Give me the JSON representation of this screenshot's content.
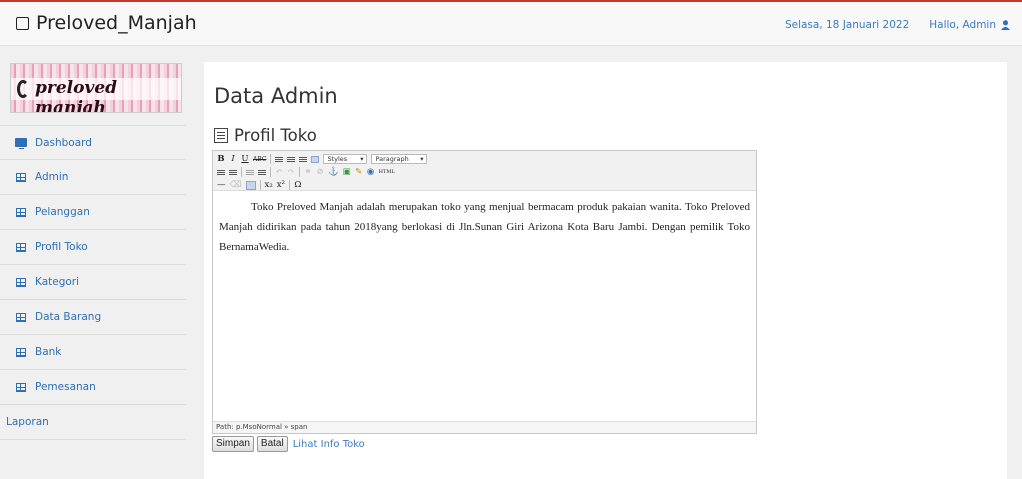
{
  "header": {
    "brand": "Preloved_Manjah",
    "date": "Selasa, 18 Januari 2022",
    "greeting": "Hallo, Admin"
  },
  "sidebar": {
    "items": [
      {
        "label": "Dashboard",
        "icon": "monitor-icon"
      },
      {
        "label": "Admin",
        "icon": "table-icon"
      },
      {
        "label": "Pelanggan",
        "icon": "table-icon"
      },
      {
        "label": "Profil Toko",
        "icon": "table-icon"
      },
      {
        "label": "Kategori",
        "icon": "table-icon"
      },
      {
        "label": "Data Barang",
        "icon": "table-icon"
      },
      {
        "label": "Bank",
        "icon": "table-icon"
      },
      {
        "label": "Pemesanan",
        "icon": "table-icon"
      },
      {
        "label": "Laporan",
        "icon": ""
      }
    ]
  },
  "main": {
    "page_title": "Data Admin",
    "section_title": "Profil Toko",
    "editor": {
      "styles_select": "Styles",
      "format_select": "Paragraph",
      "content": "Toko Preloved Manjah adalah merupakan toko yang menjual bermacam produk pakaian wanita. Toko Preloved Manjah didirikan pada tahun 2018yang berlokasi di Jln.Sunan Giri Arizona Kota Baru Jambi. Dengan pemilik Toko BernamaWedia.",
      "path": "Path: p.MsoNormal » span"
    },
    "save_label": "Simpan",
    "cancel_label": "Batal",
    "info_link": "Lihat Info Toko"
  },
  "colors": {
    "accent": "#3a7bbf",
    "top_border": "#c0392b"
  }
}
